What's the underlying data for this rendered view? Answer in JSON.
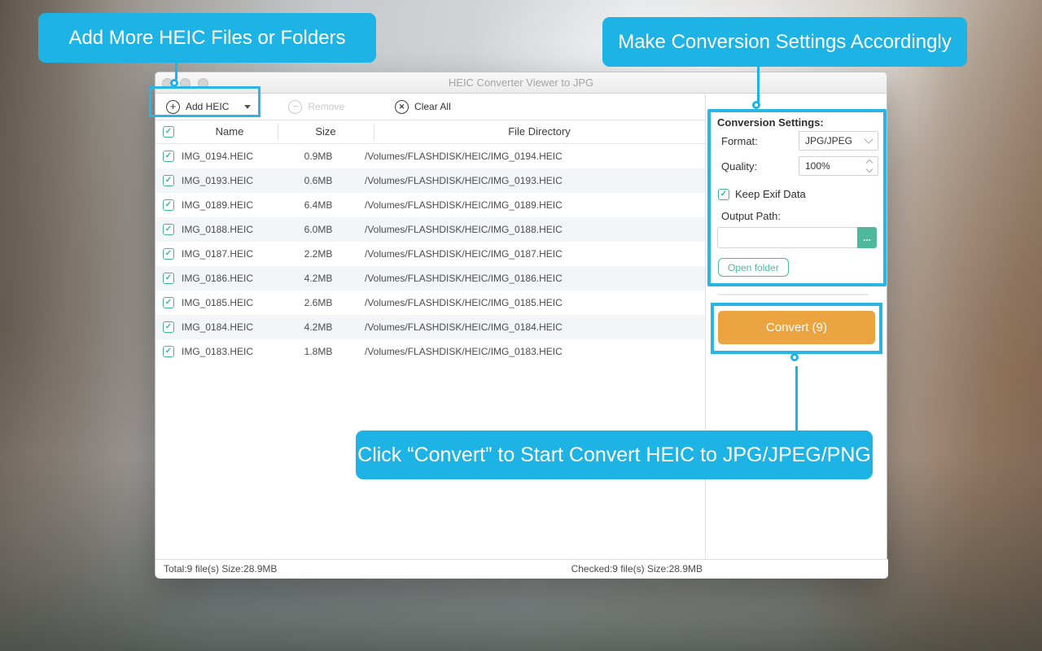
{
  "callouts": {
    "add": "Add More HEIC Files or Folders",
    "settings": "Make Conversion Settings Accordingly",
    "convert": "Click  “Convert” to Start Convert HEIC to JPG/JPEG/PNG"
  },
  "window": {
    "title": "HEIC Converter Viewer to JPG",
    "toolbar": {
      "add_label": "Add HEIC",
      "remove_label": "Remove",
      "clear_label": "Clear All"
    },
    "table": {
      "headers": {
        "name": "Name",
        "size": "Size",
        "directory": "File Directory"
      },
      "rows": [
        {
          "name": "IMG_0194.HEIC",
          "size": "0.9MB",
          "path": "/Volumes/FLASHDISK/HEIC/IMG_0194.HEIC"
        },
        {
          "name": "IMG_0193.HEIC",
          "size": "0.6MB",
          "path": "/Volumes/FLASHDISK/HEIC/IMG_0193.HEIC"
        },
        {
          "name": "IMG_0189.HEIC",
          "size": "6.4MB",
          "path": "/Volumes/FLASHDISK/HEIC/IMG_0189.HEIC"
        },
        {
          "name": "IMG_0188.HEIC",
          "size": "6.0MB",
          "path": "/Volumes/FLASHDISK/HEIC/IMG_0188.HEIC"
        },
        {
          "name": "IMG_0187.HEIC",
          "size": "2.2MB",
          "path": "/Volumes/FLASHDISK/HEIC/IMG_0187.HEIC"
        },
        {
          "name": "IMG_0186.HEIC",
          "size": "4.2MB",
          "path": "/Volumes/FLASHDISK/HEIC/IMG_0186.HEIC"
        },
        {
          "name": "IMG_0185.HEIC",
          "size": "2.6MB",
          "path": "/Volumes/FLASHDISK/HEIC/IMG_0185.HEIC"
        },
        {
          "name": "IMG_0184.HEIC",
          "size": "4.2MB",
          "path": "/Volumes/FLASHDISK/HEIC/IMG_0184.HEIC"
        },
        {
          "name": "IMG_0183.HEIC",
          "size": "1.8MB",
          "path": "/Volumes/FLASHDISK/HEIC/IMG_0183.HEIC"
        }
      ]
    },
    "status": {
      "total": "Total:9 file(s) Size:28.9MB",
      "checked": "Checked:9 file(s) Size:28.9MB"
    },
    "panel": {
      "heading": "Conversion Settings:",
      "format_label": "Format:",
      "format_value": "JPG/JPEG",
      "quality_label": "Quality:",
      "quality_value": "100%",
      "keep_exif_label": "Keep Exif Data",
      "output_label": "Output Path:",
      "output_value": "",
      "browse_label": "...",
      "open_folder_label": "Open folder",
      "convert_label": "Convert (9)"
    }
  },
  "colors": {
    "annotation_cyan": "#1db3e4",
    "highlight_cyan": "#29b6e5",
    "accent_teal": "#4eb89d",
    "convert_orange": "#eba43f",
    "row_alt": "#f3f6f9"
  }
}
